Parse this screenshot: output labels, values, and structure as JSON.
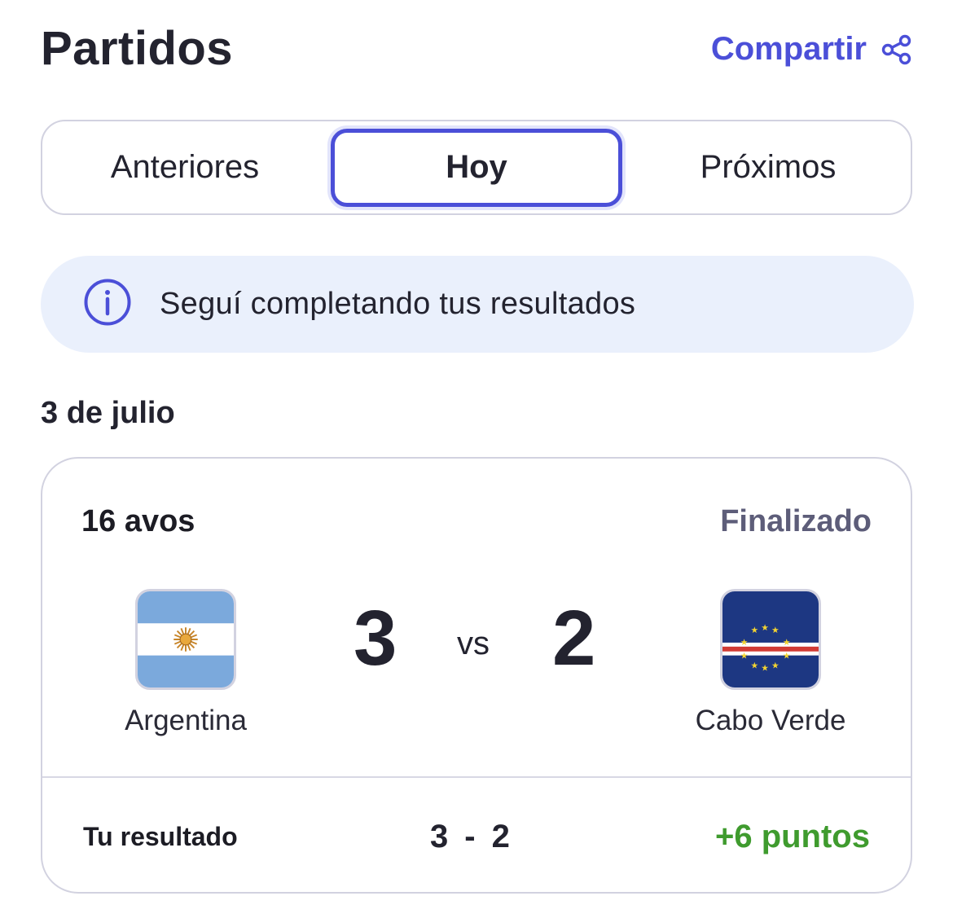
{
  "header": {
    "title": "Partidos",
    "share_label": "Compartir",
    "share_icon": "share-icon"
  },
  "tabs": [
    {
      "label": "Anteriores",
      "active": false
    },
    {
      "label": "Hoy",
      "active": true
    },
    {
      "label": "Próximos",
      "active": false
    }
  ],
  "info_banner": {
    "icon": "info-icon",
    "text": "Seguí completando tus resultados"
  },
  "date": "3 de julio",
  "match": {
    "round": "16 avos",
    "status": "Finalizado",
    "home": {
      "name": "Argentina",
      "score": "3",
      "flag": "argentina-flag-icon"
    },
    "vs": "vs",
    "away": {
      "name": "Cabo Verde",
      "score": "2",
      "flag": "cabo-verde-flag-icon"
    },
    "prediction": {
      "label": "Tu resultado",
      "home": "3",
      "separator": "-",
      "away": "2",
      "points": "+6 puntos"
    }
  },
  "colors": {
    "accent": "#4b4fd8",
    "banner_bg": "#eaf0fc",
    "status": "#5d5d79",
    "points": "#3f9b2e"
  }
}
